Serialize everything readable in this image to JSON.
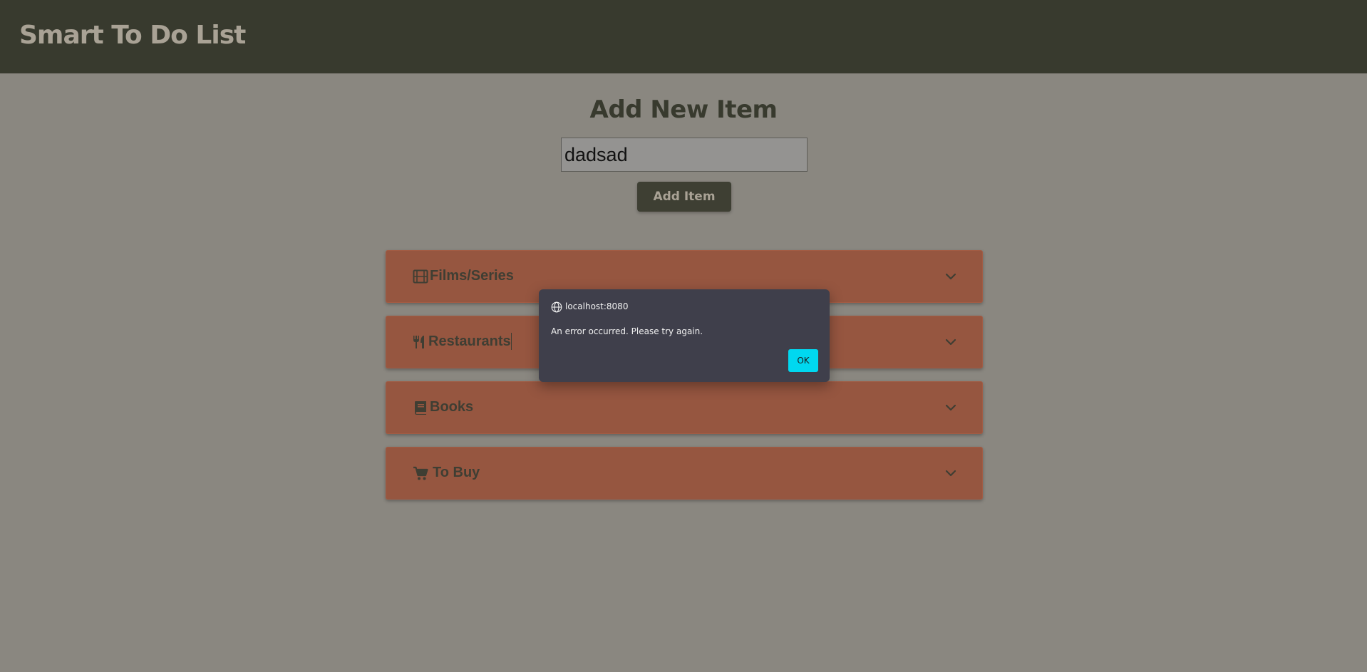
{
  "header": {
    "title": "Smart To Do List"
  },
  "form": {
    "heading": "Add New Item",
    "input_value": "dadsad",
    "add_button_label": "Add Item"
  },
  "categories": [
    {
      "label": "Films/Series",
      "icon": "film-icon"
    },
    {
      "label": "Restaurants",
      "icon": "utensils-icon"
    },
    {
      "label": "Books",
      "icon": "book-icon"
    },
    {
      "label": "To Buy",
      "icon": "cart-icon"
    }
  ],
  "dialog": {
    "origin": "localhost:8080",
    "message": "An error occurred. Please try again.",
    "ok_label": "OK"
  },
  "colors": {
    "header_bg": "#383a2e",
    "page_bg": "#8a8780",
    "category_bg": "#965640",
    "dialog_bg": "#3f3f4b",
    "ok_accent": "#00d8f0"
  }
}
